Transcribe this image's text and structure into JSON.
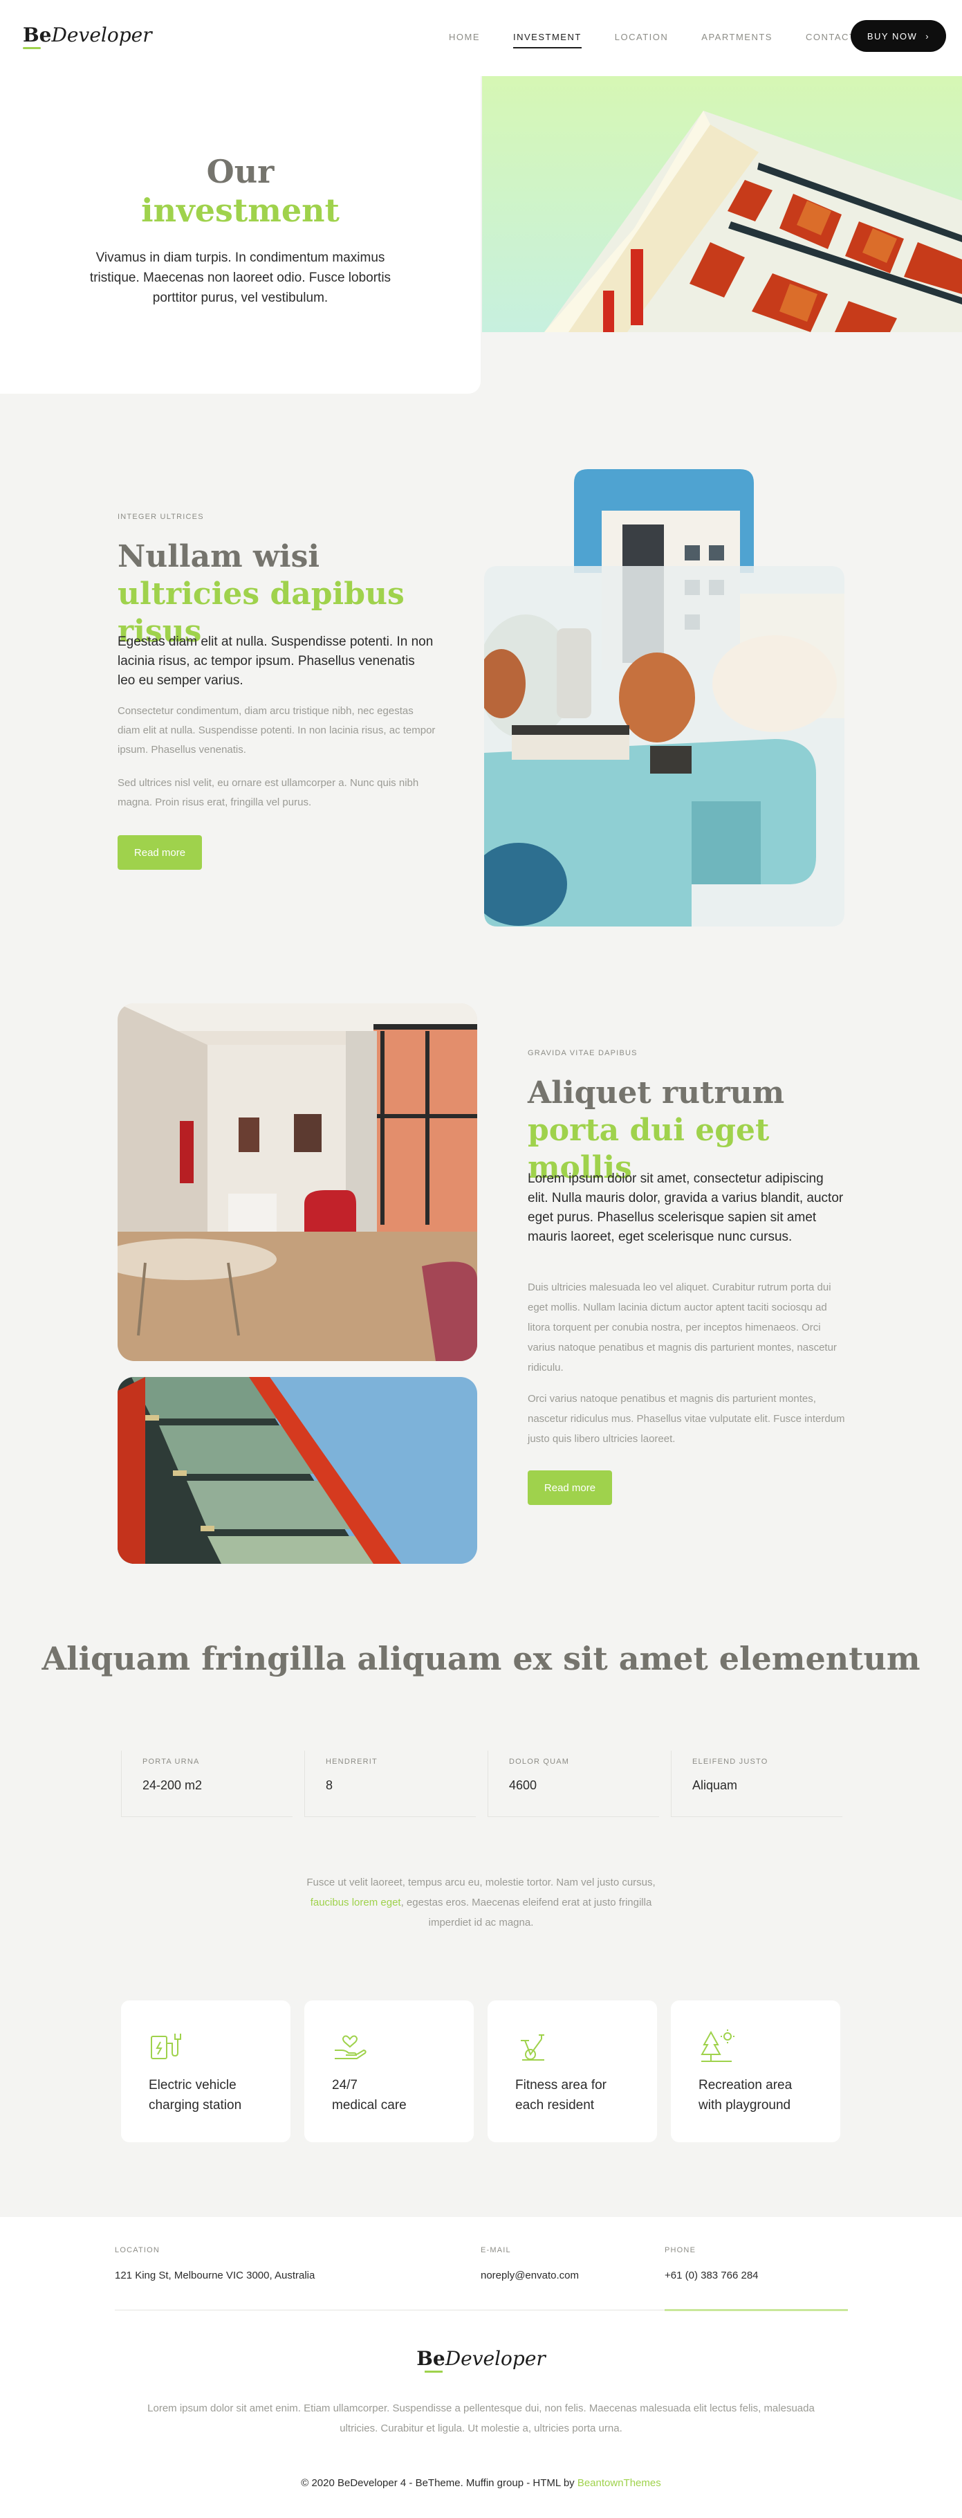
{
  "header": {
    "logo_bold": "Be",
    "logo_italic": "Developer",
    "nav": [
      "HOME",
      "INVESTMENT",
      "LOCATION",
      "APARTMENTS",
      "CONTACT"
    ],
    "buy_label": "BUY NOW",
    "buy_icon": "chevron-right-icon"
  },
  "hero": {
    "title_line1": "Our",
    "title_line2": "investment",
    "text": "Vivamus in diam turpis. In condimentum maximus tristique. Maecenas non laoreet odio. Fusce lobortis porttitor purus, vel vestibulum."
  },
  "section1": {
    "label": "INTEGER ULTRICES",
    "title_grey": "Nullam wisi",
    "title_green": "ultricies dapibus risus",
    "lead": "Egestas diam elit at nulla. Suspendisse potenti. In non lacinia risus, ac tempor ipsum. Phasellus venenatis leo eu semper varius.",
    "p1": "Consectetur condimentum, diam arcu tristique nibh, nec egestas diam elit at nulla. Suspendisse potenti. In non lacinia risus, ac tempor ipsum. Phasellus venenatis.",
    "p2": "Sed ultrices nisl velit, eu ornare est ullamcorper a. Nunc quis nibh magna. Proin risus erat, fringilla vel purus.",
    "button": "Read more"
  },
  "section2": {
    "label": "GRAVIDA VITAE DAPIBUS",
    "title_grey": "Aliquet rutrum",
    "title_green": "porta dui eget mollis",
    "lead": "Lorem ipsum dolor sit amet, consectetur adipiscing elit. Nulla mauris dolor, gravida a varius blandit, auctor eget purus. Phasellus scelerisque sapien sit amet mauris laoreet, eget scelerisque nunc cursus.",
    "p1": "Duis ultricies malesuada leo vel aliquet. Curabitur rutrum porta dui eget mollis. Nullam lacinia dictum auctor aptent taciti sociosqu ad litora torquent per conubia nostra, per inceptos himenaeos. Orci varius natoque penatibus et magnis dis parturient montes, nascetur ridiculu.",
    "p2": "Orci varius natoque penatibus et magnis dis parturient montes, nascetur ridiculus mus. Phasellus vitae vulputate elit. Fusce interdum justo quis libero ultricies laoreet.",
    "button": "Read more"
  },
  "stats": {
    "title": "Aliquam fringilla aliquam ex sit amet elementum",
    "items": [
      {
        "label": "PORTA URNA",
        "value": "24-200 m2"
      },
      {
        "label": "HENDRERIT",
        "value": "8"
      },
      {
        "label": "DOLOR QUAM",
        "value": "4600"
      },
      {
        "label": "ELEIFEND JUSTO",
        "value": "Aliquam"
      }
    ],
    "text_before": "Fusce ut velit laoreet, tempus arcu eu, molestie tortor. Nam vel justo cursus,",
    "text_link": "faucibus lorem eget",
    "text_after": ", egestas eros. Maecenas eleifend erat at justo fringilla imperdiet id ac magna."
  },
  "features": [
    {
      "icon": "ev-charging-icon",
      "line1": "Electric vehicle",
      "line2": "charging station"
    },
    {
      "icon": "medical-care-icon",
      "line1": "24/7",
      "line2": "medical care"
    },
    {
      "icon": "fitness-bike-icon",
      "line1": "Fitness area for",
      "line2": "each resident"
    },
    {
      "icon": "playground-tree-icon",
      "line1": "Recreation area",
      "line2": "with playground"
    }
  ],
  "footer": {
    "location_label": "LOCATION",
    "location_value": "121 King St, Melbourne VIC 3000, Australia",
    "email_label": "E-MAIL",
    "email_value": "noreply@envato.com",
    "phone_label": "PHONE",
    "phone_value": "+61 (0) 383 766 284",
    "logo_bold": "Be",
    "logo_italic": "Developer",
    "description": "Lorem ipsum dolor sit amet enim. Etiam ullamcorper. Suspendisse a pellentesque dui, non felis. Maecenas malesuada elit lectus felis, malesuada ultricies. Curabitur et ligula. Ut molestie a, ultricies porta urna.",
    "copyright": "© 2020 BeDeveloper 4 - BeTheme. Muffin group - HTML by",
    "copyright_link": "BeantownThemes"
  },
  "colors": {
    "accent": "#9fd24c",
    "title_grey": "#75746d",
    "background": "#f4f4f2"
  }
}
